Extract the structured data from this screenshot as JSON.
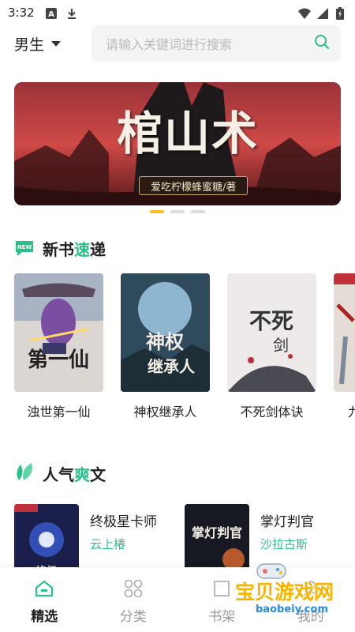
{
  "status_bar": {
    "time": "3:32",
    "icons_left": [
      "font-icon",
      "download-icon"
    ],
    "icons_right": [
      "wifi-icon",
      "signal-icon",
      "battery-icon"
    ]
  },
  "header": {
    "gender_label": "男生",
    "search_placeholder": "请输入关键词进行搜索"
  },
  "banner": {
    "title": "棺山术",
    "author": "爱吃柠檬蜂蜜糖/著",
    "active_index": 0,
    "slide_count": 3
  },
  "new_books": {
    "title_prefix": "新书",
    "title_accent": "速",
    "title_suffix": "递",
    "items": [
      {
        "name": "浊世第一仙"
      },
      {
        "name": "神权继承人"
      },
      {
        "name": "不死剑体诀"
      },
      {
        "name": "九"
      }
    ]
  },
  "hot_books": {
    "title_prefix": "人气",
    "title_accent": "爽",
    "title_suffix": "文",
    "items": [
      {
        "name": "终极星卡师",
        "author": "云上椿"
      },
      {
        "name": "掌灯判官",
        "author": "沙拉古斯"
      }
    ]
  },
  "tab_bar": {
    "tabs": [
      {
        "label": "精选",
        "active": true
      },
      {
        "label": "分类",
        "active": false
      },
      {
        "label": "书架",
        "active": false
      },
      {
        "label": "我的",
        "active": false
      }
    ]
  },
  "watermark": {
    "title": "宝贝游戏网",
    "url": "baobeiy.com"
  },
  "colors": {
    "accent_green": "#2bbf8a",
    "dot_active": "#f5c020"
  }
}
